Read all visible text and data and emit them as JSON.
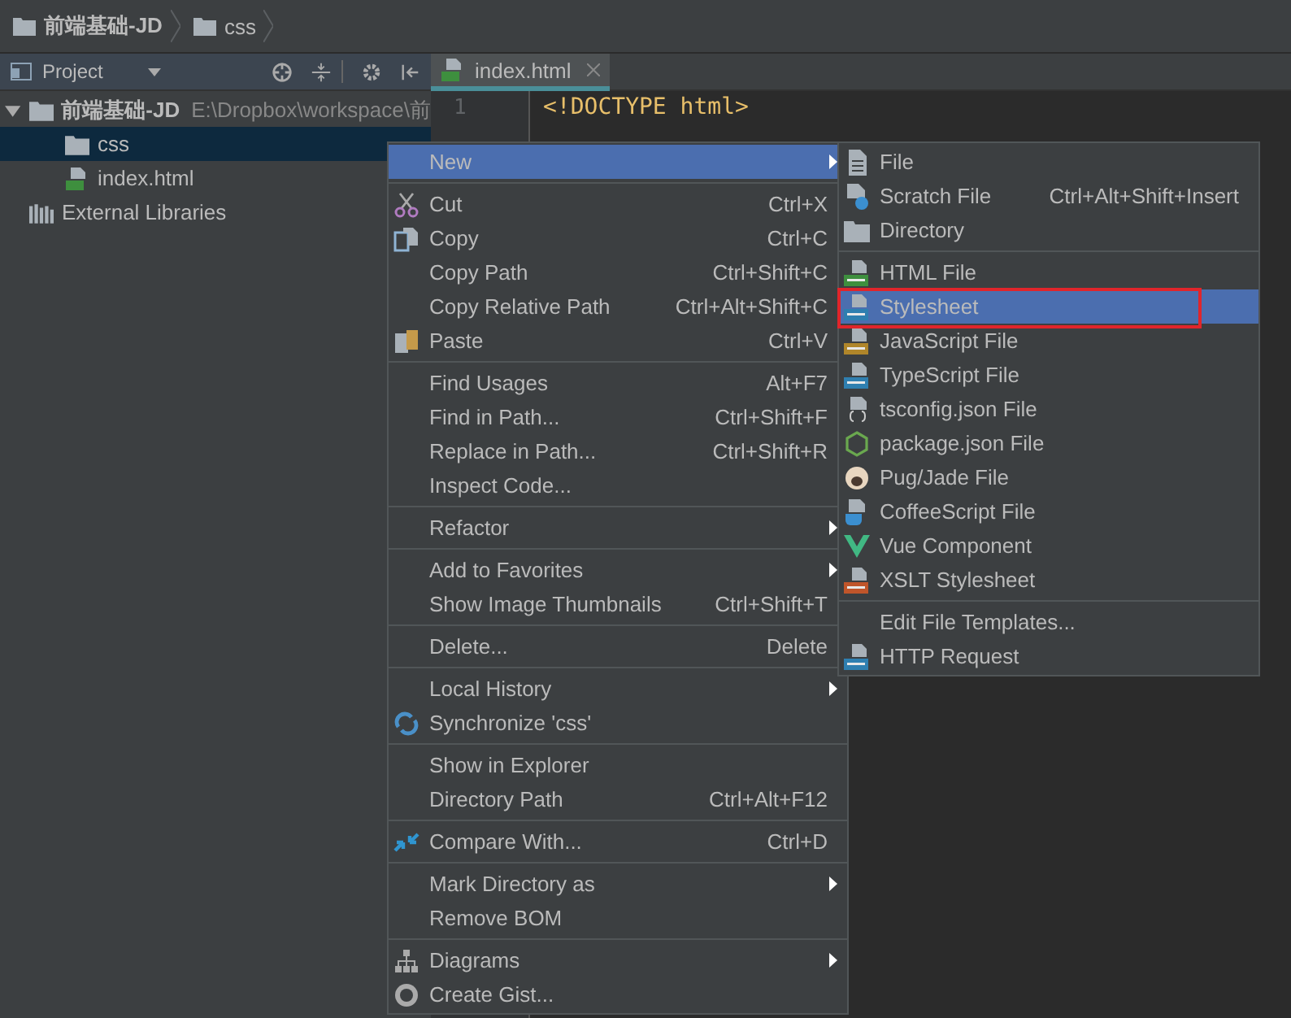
{
  "breadcrumb": [
    "前端基础-JD",
    "css"
  ],
  "project_panel": {
    "title": "Project"
  },
  "tree": [
    {
      "label": "前端基础-JD",
      "path": "E:\\Dropbox\\workspace\\前",
      "kind": "folder",
      "expanded": true,
      "selected": false,
      "children": [
        {
          "label": "css",
          "kind": "folder",
          "selected": true
        },
        {
          "label": "index.html",
          "kind": "html",
          "selected": false
        }
      ]
    },
    {
      "label": "External Libraries",
      "kind": "library",
      "selected": false
    }
  ],
  "editor": {
    "tab": "index.html",
    "lines": [
      {
        "number": "1",
        "code": "<!DOCTYPE html>"
      }
    ]
  },
  "context_menu": {
    "groups": [
      [
        {
          "label": "New",
          "kind": "none",
          "submenu": true,
          "selected": true
        }
      ],
      [
        {
          "label": "Cut",
          "kind": "cut",
          "shortcut": "Ctrl+X",
          "submenu": false,
          "selected": false
        },
        {
          "label": "Copy",
          "kind": "copy",
          "shortcut": "Ctrl+C",
          "submenu": false,
          "selected": false
        },
        {
          "label": "Copy Path",
          "kind": "none",
          "shortcut": "Ctrl+Shift+C",
          "submenu": false,
          "selected": false
        },
        {
          "label": "Copy Relative Path",
          "kind": "none",
          "shortcut": "Ctrl+Alt+Shift+C",
          "submenu": false,
          "selected": false
        },
        {
          "label": "Paste",
          "kind": "paste",
          "shortcut": "Ctrl+V",
          "submenu": false,
          "selected": false
        }
      ],
      [
        {
          "label": "Find Usages",
          "kind": "none",
          "shortcut": "Alt+F7",
          "submenu": false,
          "selected": false
        },
        {
          "label": "Find in Path...",
          "kind": "none",
          "shortcut": "Ctrl+Shift+F",
          "submenu": false,
          "selected": false
        },
        {
          "label": "Replace in Path...",
          "kind": "none",
          "shortcut": "Ctrl+Shift+R",
          "submenu": false,
          "selected": false
        },
        {
          "label": "Inspect Code...",
          "kind": "none",
          "submenu": false,
          "selected": false
        }
      ],
      [
        {
          "label": "Refactor",
          "kind": "none",
          "submenu": true,
          "selected": false
        }
      ],
      [
        {
          "label": "Add to Favorites",
          "kind": "none",
          "submenu": true,
          "selected": false
        },
        {
          "label": "Show Image Thumbnails",
          "kind": "none",
          "shortcut": "Ctrl+Shift+T",
          "submenu": false,
          "selected": false
        }
      ],
      [
        {
          "label": "Delete...",
          "kind": "none",
          "shortcut": "Delete",
          "submenu": false,
          "selected": false
        }
      ],
      [
        {
          "label": "Local History",
          "kind": "none",
          "submenu": true,
          "selected": false
        },
        {
          "label": "Synchronize 'css'",
          "kind": "sync",
          "submenu": false,
          "selected": false
        }
      ],
      [
        {
          "label": "Show in Explorer",
          "kind": "none",
          "submenu": false,
          "selected": false
        },
        {
          "label": "Directory Path",
          "kind": "none",
          "shortcut": "Ctrl+Alt+F12",
          "submenu": false,
          "selected": false
        }
      ],
      [
        {
          "label": "Compare With...",
          "kind": "compare",
          "shortcut": "Ctrl+D",
          "submenu": false,
          "selected": false
        }
      ],
      [
        {
          "label": "Mark Directory as",
          "kind": "none",
          "submenu": true,
          "selected": false
        },
        {
          "label": "Remove BOM",
          "kind": "none",
          "submenu": false,
          "selected": false
        }
      ],
      [
        {
          "label": "Diagrams",
          "kind": "diagrams",
          "submenu": true,
          "selected": false
        },
        {
          "label": "Create Gist...",
          "kind": "gist",
          "submenu": false,
          "selected": false
        }
      ]
    ]
  },
  "new_submenu": {
    "groups": [
      [
        {
          "label": "File",
          "kind": "file",
          "selected": false,
          "outlined": false
        },
        {
          "label": "Scratch File",
          "kind": "scratch",
          "shortcut": "Ctrl+Alt+Shift+Insert",
          "selected": false,
          "outlined": false
        },
        {
          "label": "Directory",
          "kind": "folder",
          "selected": false,
          "outlined": false
        }
      ],
      [
        {
          "label": "HTML File",
          "kind": "html",
          "selected": false,
          "outlined": false
        },
        {
          "label": "Stylesheet",
          "kind": "css",
          "selected": true,
          "outlined": true
        },
        {
          "label": "JavaScript File",
          "kind": "js",
          "selected": false,
          "outlined": false
        },
        {
          "label": "TypeScript File",
          "kind": "ts",
          "selected": false,
          "outlined": false
        },
        {
          "label": "tsconfig.json File",
          "kind": "tsconfig",
          "selected": false,
          "outlined": false
        },
        {
          "label": "package.json File",
          "kind": "npm",
          "selected": false,
          "outlined": false
        },
        {
          "label": "Pug/Jade File",
          "kind": "pug",
          "selected": false,
          "outlined": false
        },
        {
          "label": "CoffeeScript File",
          "kind": "coffee",
          "selected": false,
          "outlined": false
        },
        {
          "label": "Vue Component",
          "kind": "vue",
          "selected": false,
          "outlined": false
        },
        {
          "label": "XSLT Stylesheet",
          "kind": "xslt",
          "selected": false,
          "outlined": false
        }
      ],
      [
        {
          "label": "Edit File Templates...",
          "kind": "none",
          "selected": false,
          "outlined": false
        },
        {
          "label": "HTTP Request",
          "kind": "http",
          "selected": false,
          "outlined": false
        }
      ]
    ]
  }
}
